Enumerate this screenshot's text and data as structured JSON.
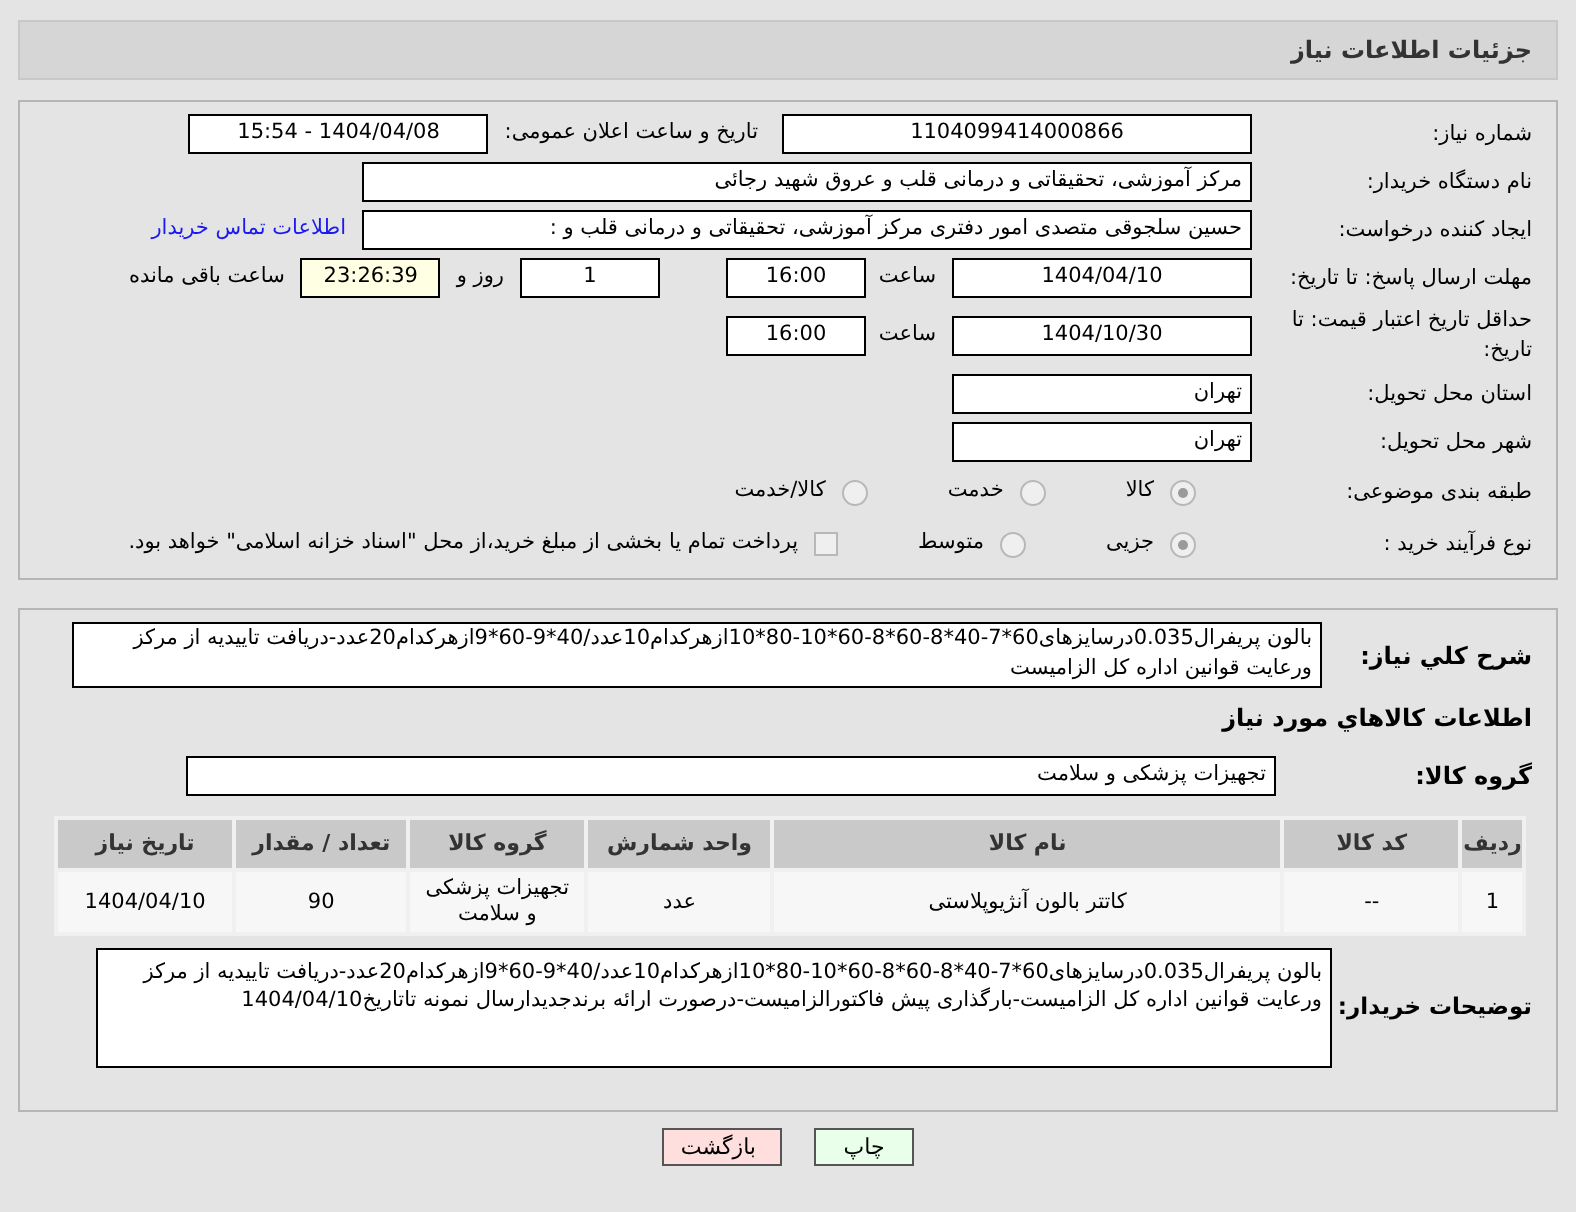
{
  "header": {
    "title": "جزئیات اطلاعات نیاز"
  },
  "fields": {
    "need_number": {
      "label": "شماره نیاز:",
      "value": "1104099414000866"
    },
    "announce": {
      "label": "تاریخ و ساعت اعلان عمومی:",
      "value": "1404/04/08 - 15:54"
    },
    "buyer": {
      "label": "نام دستگاه خریدار:",
      "value": "مرکز آموزشی، تحقیقاتی و درمانی قلب و عروق شهید رجائی"
    },
    "requester": {
      "label": "ایجاد کننده درخواست:",
      "value": "حسین سلجوقی متصدی امور دفتری مرکز آموزشی، تحقیقاتی و درمانی قلب و :",
      "link": "اطلاعات تماس خریدار"
    },
    "deadline": {
      "label": "مهلت ارسال پاسخ: تا تاریخ:",
      "date": "1404/04/10",
      "time_label": "ساعت",
      "time": "16:00",
      "days": "1",
      "days_label": "روز و",
      "remaining": "23:26:39",
      "remaining_label": "ساعت باقی مانده"
    },
    "validity": {
      "label": "حداقل تاریخ اعتبار قیمت: تا تاریخ:",
      "date": "1404/10/30",
      "time_label": "ساعت",
      "time": "16:00"
    },
    "province": {
      "label": "استان محل تحویل:",
      "value": "تهران"
    },
    "city": {
      "label": "شهر محل تحویل:",
      "value": "تهران"
    },
    "category": {
      "label": "طبقه بندی موضوعی:",
      "options": [
        {
          "label": "کالا",
          "selected": true
        },
        {
          "label": "خدمت",
          "selected": false
        },
        {
          "label": "کالا/خدمت",
          "selected": false
        }
      ]
    },
    "purchase_type": {
      "label": "نوع فرآیند خرید :",
      "options": [
        {
          "label": "جزیی",
          "selected": true
        },
        {
          "label": "متوسط",
          "selected": false
        }
      ],
      "payment": {
        "label": "پرداخت تمام یا بخشی از مبلغ خرید،از محل \"اسناد خزانه اسلامی\" خواهد بود.",
        "checked": false
      }
    }
  },
  "summary": {
    "label": "شرح کلي نياز:",
    "value": "بالون پریفرال0.035درسایزهای60*7-40*8-60*8-60*10-80*10ازهرکدام10عدد/40*9-60*9ازهرکدام20عدد-دریافت تاییدیه از مرکز ورعایت قوانین اداره کل الزامیست"
  },
  "goods_title": "اطلاعات کالاهاي مورد نياز",
  "goods_group": {
    "label": "گروه کالا:",
    "value": "تجهیزات پزشکی و سلامت"
  },
  "table": {
    "columns": [
      "ردیف",
      "کد کالا",
      "نام کالا",
      "واحد شمارش",
      "گروه کالا",
      "تعداد / مقدار",
      "تاریخ نیاز"
    ],
    "rows": [
      [
        "1",
        "--",
        "کاتتر بالون آنژیوپلاستی",
        "عدد",
        "تجهیزات پزشکی و سلامت",
        "90",
        "1404/04/10"
      ]
    ]
  },
  "buyer_notes": {
    "label": "توضیحات خریدار:",
    "value": "بالون پریفرال0.035درسایزهای60*7-40*8-60*8-60*10-80*10ازهرکدام10عدد/40*9-60*9ازهرکدام20عدد-دریافت تاییدیه از مرکز ورعایت قوانین اداره کل الزامیست-بارگذاری پیش فاکتورالزامیست-درصورت ارائه برندجدیدارسال نمونه تاتاریخ1404/04/10"
  },
  "buttons": [
    {
      "label": "چاپ",
      "kind": "print"
    },
    {
      "label": "بازگشت",
      "kind": "back"
    }
  ]
}
